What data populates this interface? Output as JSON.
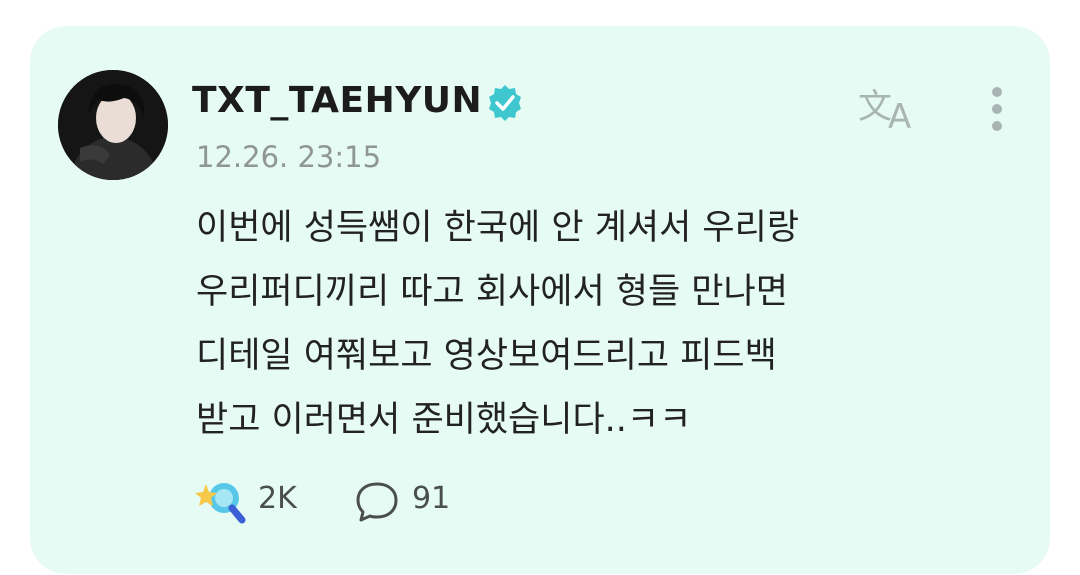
{
  "post": {
    "username": "TXT_TAEHYUN",
    "timestamp": "12.26. 23:15",
    "body_lines": [
      "이번에 성득쌤이 한국에 안 계셔서 우리랑",
      "우리퍼디끼리 따고 회사에서 형들 만나면",
      "디테일 여쭤보고 영상보여드리고 피드백",
      "받고 이러면서 준비했습니다..ㅋㅋ"
    ],
    "reaction_count": "2K",
    "comment_count": "91"
  },
  "icons": {
    "verified": "verified-badge-icon",
    "translate": "translate-icon",
    "more": "more-vertical-icon",
    "reaction": "reaction-icon",
    "comment": "comment-bubble-icon"
  },
  "colors": {
    "card_background": "#e6fbf4",
    "verified": "#3fc7cf",
    "icon_gray": "#a9b5b2",
    "text": "#222222",
    "meta_text": "#8f9694"
  }
}
